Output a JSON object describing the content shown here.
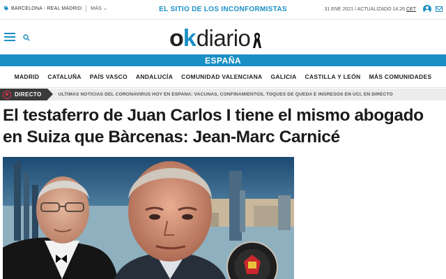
{
  "topbar": {
    "match_label": "BARCELONA - REAL MADRID",
    "more_label": "MÁS",
    "tagline": "EL SITIO DE LOS INCONFORMISTAS",
    "date": "31 ENE 2021 / ACTUALIZADO 14:26",
    "timezone": "CET"
  },
  "logo": {
    "ok": "ok",
    "diario": "diario"
  },
  "section": {
    "title": "ESPAÑA"
  },
  "nav": {
    "items": [
      {
        "label": "MADRID"
      },
      {
        "label": "CATALUÑA"
      },
      {
        "label": "PAÍS VASCO"
      },
      {
        "label": "ANDALUCÍA"
      },
      {
        "label": "COMUNIDAD VALENCIANA"
      },
      {
        "label": "GALICIA"
      },
      {
        "label": "CASTILLA Y LEÓN"
      },
      {
        "label": "MÁS COMUNIDADES"
      }
    ]
  },
  "directo": {
    "label": "DIRECTO",
    "text": "ÚLTIMAS NOTICIAS DEL CORONAVIRUS HOY EN ESPAÑA: VACUNAS, CONFINAMIENTOS, TOQUES DE QUEDA E INGRESOS EN UCI, EN DIRECTO"
  },
  "article": {
    "headline": "El testaferro de Juan Carlos I tiene el mismo abogado en Suiza que Bàrcenas: Jean-Marc Carnicé"
  },
  "colors": {
    "brand": "#1a8fc5",
    "live": "#e0304a",
    "directo_bg": "#3a3a3a"
  }
}
